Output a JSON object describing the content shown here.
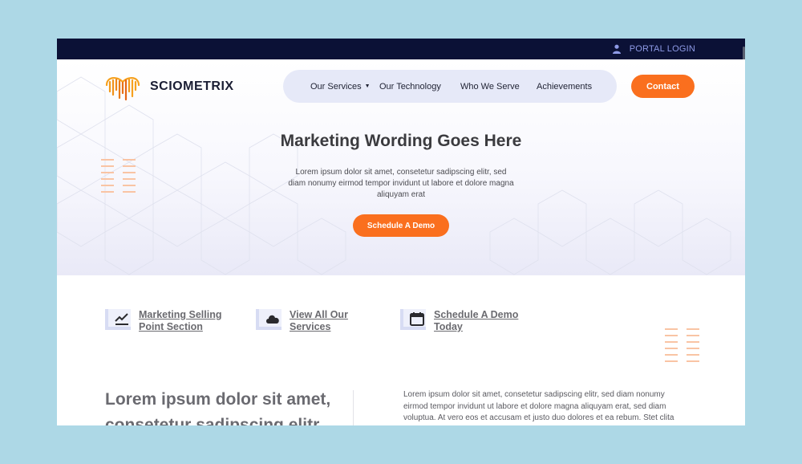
{
  "topbar": {
    "portal_login": "PORTAL LOGIN"
  },
  "brand": {
    "name": "SCIOMETRIX"
  },
  "nav": {
    "items": [
      "Our Services",
      "Our Technology",
      "Who We Serve",
      "Achievements"
    ],
    "contact": "Contact"
  },
  "hero": {
    "title": "Marketing Wording Goes Here",
    "subtitle": "Lorem ipsum dolor sit amet, consetetur sadipscing elitr, sed diam nonumy eirmod tempor invidunt ut labore et dolore magna aliquyam erat",
    "cta": "Schedule A Demo"
  },
  "features": [
    {
      "line1": "Marketing Selling",
      "line2": "Point Section",
      "icon": "trending-chart-icon"
    },
    {
      "line1": "View All Our",
      "line2": "Services",
      "icon": "cloud-icon"
    },
    {
      "line1": "Schedule A Demo",
      "line2": "Today",
      "icon": "calendar-icon"
    }
  ],
  "intro": {
    "heading_line1": "Lorem ipsum dolor sit amet,",
    "heading_line2": "consetetur sadipscing elitr,",
    "paragraph": "Lorem ipsum dolor sit amet, consetetur sadipscing elitr, sed diam nonumy eirmod tempor invidunt ut labore et dolore magna aliquyam erat, sed diam voluptua. At vero eos et accusam et justo duo dolores et ea rebum. Stet clita"
  },
  "colors": {
    "accent": "#fa6f1e",
    "topbar": "#0b1136",
    "nav_bg": "#e6e9f8",
    "page_bg": "#add8e6"
  }
}
